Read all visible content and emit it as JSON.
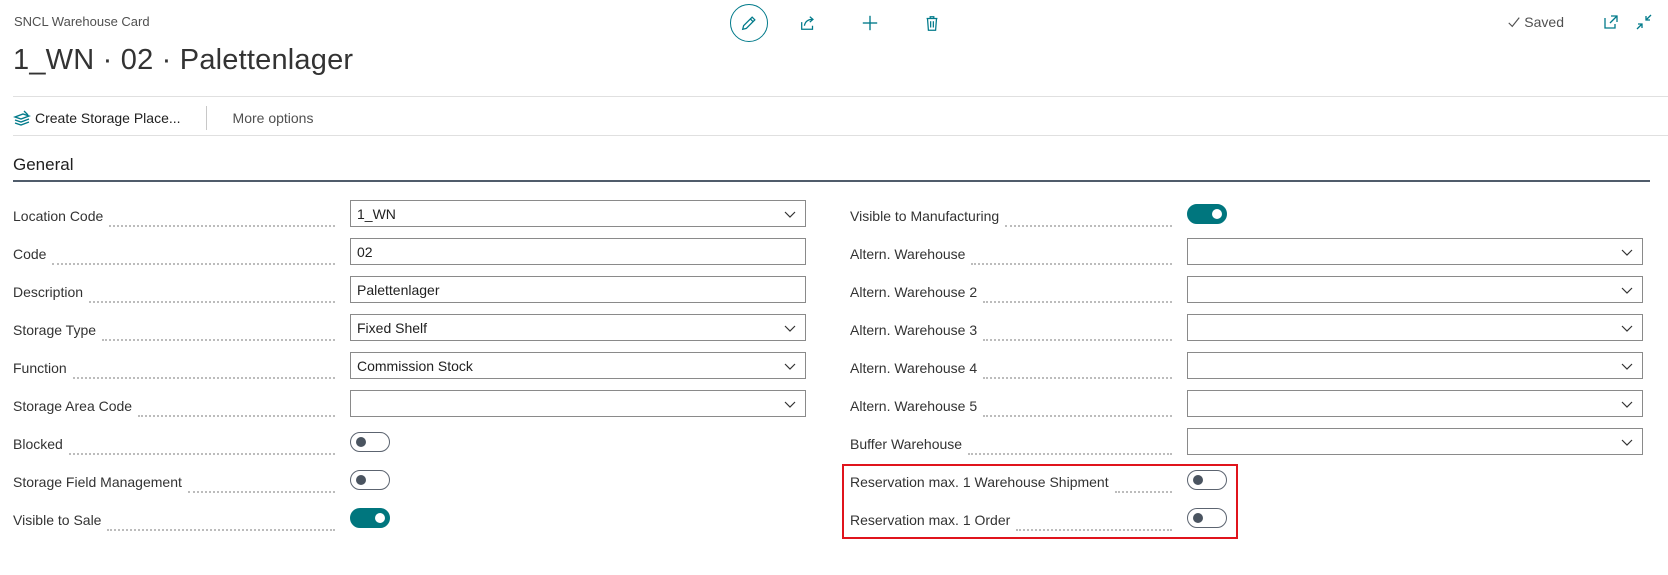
{
  "header": {
    "card_title": "SNCL Warehouse Card",
    "record_title": "1_WN · 02 · Palettenlager",
    "saved_label": "Saved"
  },
  "actions": {
    "create_storage_place": "Create Storage Place...",
    "more_options": "More options"
  },
  "section": {
    "title": "General"
  },
  "left_fields": [
    {
      "label": "Location Code",
      "type": "select",
      "value": "1_WN"
    },
    {
      "label": "Code",
      "type": "text",
      "value": "02"
    },
    {
      "label": "Description",
      "type": "text",
      "value": "Palettenlager"
    },
    {
      "label": "Storage Type",
      "type": "select",
      "value": "Fixed Shelf"
    },
    {
      "label": "Function",
      "type": "select",
      "value": "Commission Stock"
    },
    {
      "label": "Storage Area Code",
      "type": "select",
      "value": ""
    },
    {
      "label": "Blocked",
      "type": "toggle",
      "on": false
    },
    {
      "label": "Storage Field Management",
      "type": "toggle",
      "on": false
    },
    {
      "label": "Visible to Sale",
      "type": "toggle",
      "on": true
    }
  ],
  "right_fields": [
    {
      "label": "Visible to Manufacturing",
      "type": "toggle",
      "on": true
    },
    {
      "label": "Altern. Warehouse",
      "type": "select",
      "value": ""
    },
    {
      "label": "Altern. Warehouse 2",
      "type": "select",
      "value": ""
    },
    {
      "label": "Altern. Warehouse 3",
      "type": "select",
      "value": ""
    },
    {
      "label": "Altern. Warehouse 4",
      "type": "select",
      "value": ""
    },
    {
      "label": "Altern. Warehouse 5",
      "type": "select",
      "value": ""
    },
    {
      "label": "Buffer Warehouse",
      "type": "select",
      "value": ""
    },
    {
      "label": "Reservation max. 1 Warehouse Shipment",
      "type": "toggle",
      "on": false
    },
    {
      "label": "Reservation max. 1 Order",
      "type": "toggle",
      "on": false
    }
  ],
  "colors": {
    "accent": "#00767e",
    "highlight_box": "#e0141c",
    "section_rule": "#505c6b"
  },
  "icons": {
    "edit": "pencil-icon",
    "share": "share-icon",
    "new": "plus-icon",
    "delete": "trash-icon",
    "saved": "checkmark-icon",
    "open_new_window": "open-in-new-window-icon",
    "collapse": "collapse-icon",
    "create_storage": "stack-create-icon",
    "dropdown": "chevron-down-icon"
  }
}
